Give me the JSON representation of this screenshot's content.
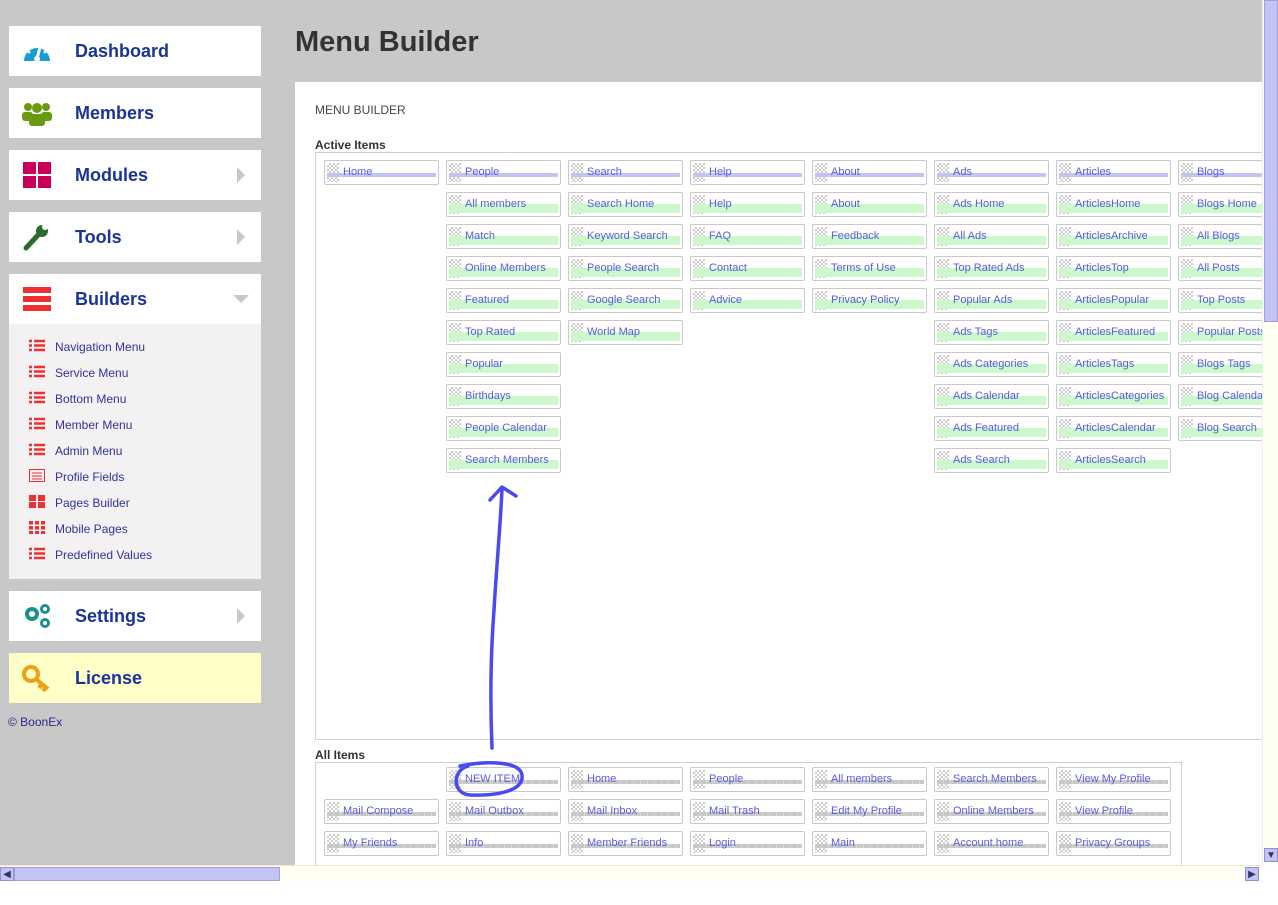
{
  "sidebar": {
    "items": [
      {
        "label": "Dashboard",
        "icon": "dashboard-icon",
        "color": "#1a9ad6"
      },
      {
        "label": "Members",
        "icon": "members-icon",
        "color": "#6a9a10"
      },
      {
        "label": "Modules",
        "icon": "modules-icon",
        "color": "#c8005a"
      },
      {
        "label": "Tools",
        "icon": "wrench-icon",
        "color": "#2c6a2c"
      },
      {
        "label": "Builders",
        "icon": "builders-icon",
        "color": "#f03030"
      }
    ],
    "submenu": [
      "Navigation Menu",
      "Service Menu",
      "Bottom Menu",
      "Member Menu",
      "Admin Menu",
      "Profile Fields",
      "Pages Builder",
      "Mobile Pages",
      "Predefined Values"
    ],
    "settings": "Settings",
    "license": "License",
    "copyright": "© BoonEx"
  },
  "page_title": "Menu Builder",
  "panel_title": "MENU BUILDER",
  "active_label": "Active Items",
  "all_label": "All Items",
  "active_columns": [
    [
      "Home"
    ],
    [
      "People",
      "All members",
      "Match",
      "Online Members",
      "Featured",
      "Top Rated",
      "Popular",
      "Birthdays",
      "People Calendar",
      "Search Members"
    ],
    [
      "Search",
      "Search Home",
      "Keyword Search",
      "People Search",
      "Google Search",
      "World Map"
    ],
    [
      "Help",
      "Help",
      "FAQ",
      "Contact",
      "Advice"
    ],
    [
      "About",
      "About",
      "Feedback",
      "Terms of Use",
      "Privacy Policy"
    ],
    [
      "Ads",
      "Ads Home",
      "All Ads",
      "Top Rated Ads",
      "Popular Ads",
      "Ads Tags",
      "Ads Categories",
      "Ads Calendar",
      "Ads Featured",
      "Ads Search"
    ],
    [
      "Articles",
      "ArticlesHome",
      "ArticlesArchive",
      "ArticlesTop",
      "ArticlesPopular",
      "ArticlesFeatured",
      "ArticlesTags",
      "ArticlesCategories",
      "ArticlesCalendar",
      "ArticlesSearch"
    ],
    [
      "Blogs",
      "Blogs Home",
      "All Blogs",
      "All Posts",
      "Top Posts",
      "Popular Posts",
      "Blogs Tags",
      "Blog Calendar",
      "Blog Search"
    ]
  ],
  "all_rows": [
    [
      "",
      "NEW ITEM",
      "Home",
      "People",
      "All members",
      "Search Members",
      "View My Profile"
    ],
    [
      "Mail Compose",
      "Mail Outbox",
      "Mail Inbox",
      "Mail Trash",
      "Edit My Profile",
      "Online Members",
      "View Profile"
    ],
    [
      "My Friends",
      "Info",
      "Member Friends",
      "Login",
      "Main",
      "Account home",
      "Privacy Groups"
    ]
  ],
  "annotation_color": "#4a4af0"
}
